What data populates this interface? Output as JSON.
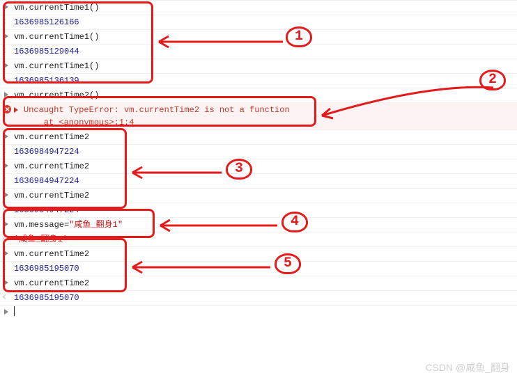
{
  "rows": [
    {
      "kind": "input",
      "text": "vm.currentTime1()"
    },
    {
      "kind": "output",
      "cls": "num",
      "text": "1636985126166"
    },
    {
      "kind": "input",
      "text": "vm.currentTime1()"
    },
    {
      "kind": "output",
      "cls": "num",
      "text": "1636985129044"
    },
    {
      "kind": "input",
      "text": "vm.currentTime1()"
    },
    {
      "kind": "output",
      "cls": "num",
      "text": "1636985136139"
    },
    {
      "kind": "input",
      "text": "vm.currentTime2()"
    },
    {
      "kind": "error",
      "text": "Uncaught TypeError: vm.currentTime2 is not a function\n    at <anonymous>:1:4"
    },
    {
      "kind": "input",
      "text": "vm.currentTime2"
    },
    {
      "kind": "output",
      "cls": "num",
      "text": "1636984947224"
    },
    {
      "kind": "input",
      "text": "vm.currentTime2"
    },
    {
      "kind": "output",
      "cls": "num",
      "text": "1636984947224"
    },
    {
      "kind": "input",
      "text": "vm.currentTime2"
    },
    {
      "kind": "output",
      "cls": "num",
      "text": "1636984947224"
    },
    {
      "kind": "assign",
      "prefix": "vm.message=",
      "value": "\"咸鱼_翻身1\""
    },
    {
      "kind": "output",
      "cls": "str",
      "text": "'咸鱼_翻身1'"
    },
    {
      "kind": "input",
      "text": "vm.currentTime2"
    },
    {
      "kind": "output",
      "cls": "num",
      "text": "1636985195070"
    },
    {
      "kind": "input",
      "text": "vm.currentTime2"
    },
    {
      "kind": "output",
      "cls": "num",
      "text": "1636985195070"
    }
  ],
  "labels": {
    "l1": "1",
    "l2": "2",
    "l3": "3",
    "l4": "4",
    "l5": "5"
  },
  "watermark": "CSDN @咸鱼_翻身"
}
